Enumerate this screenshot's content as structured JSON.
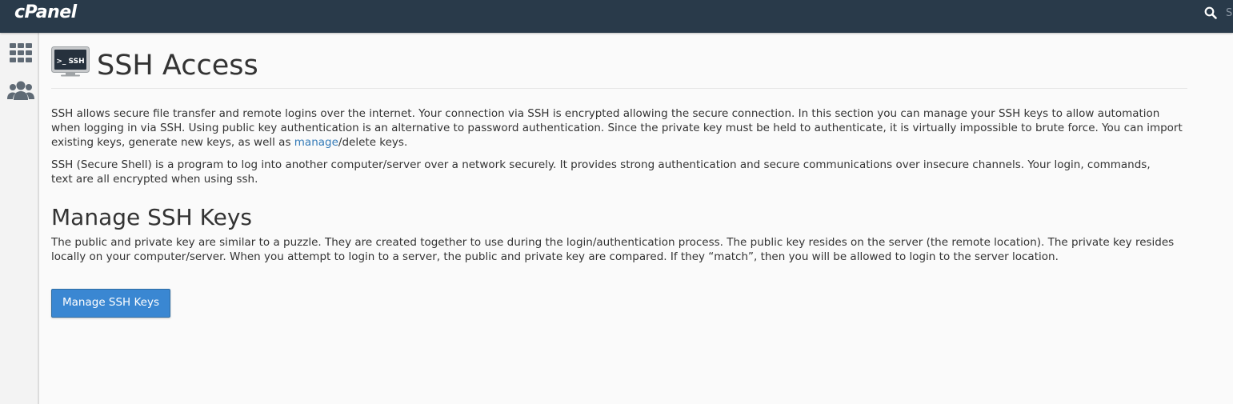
{
  "brand": {
    "logo_text": "cPanel"
  },
  "topbar": {
    "search_placeholder": "Search"
  },
  "sidebar": {
    "items": [
      {
        "icon": "grid-icon"
      },
      {
        "icon": "users-icon"
      }
    ]
  },
  "page": {
    "icon_label": ">_ SSH",
    "title": "SSH Access",
    "intro": {
      "before_link": "SSH allows secure file transfer and remote logins over the internet. Your connection via SSH is encrypted allowing the secure connection. In this section you can manage your SSH keys to allow automation when logging in via SSH. Using public key authentication is an alternative to password authentication. Since the private key must be held to authenticate, it is virtually impossible to brute force. You can import existing keys, generate new keys, as well as ",
      "link_text": "manage",
      "after_link": "/delete keys."
    },
    "description": "SSH (Secure Shell) is a program to log into another computer/server over a network securely. It provides strong authentication and secure communications over insecure channels. Your login, commands, text are all encrypted when using ssh.",
    "manage_section": {
      "title": "Manage SSH Keys",
      "body": "The public and private key are similar to a puzzle. They are created together to use during the login/authentication process. The public key resides on the server (the remote location). The private key resides locally on your computer/server. When you attempt to login to a server, the public and private key are compared. If they “match”, then you will be allowed to login to the server location.",
      "button_label": "Manage SSH Keys"
    }
  },
  "colors": {
    "topbar": "#293a4a",
    "link": "#337ab7",
    "button": "#3a87d2",
    "background": "#fafafa"
  }
}
